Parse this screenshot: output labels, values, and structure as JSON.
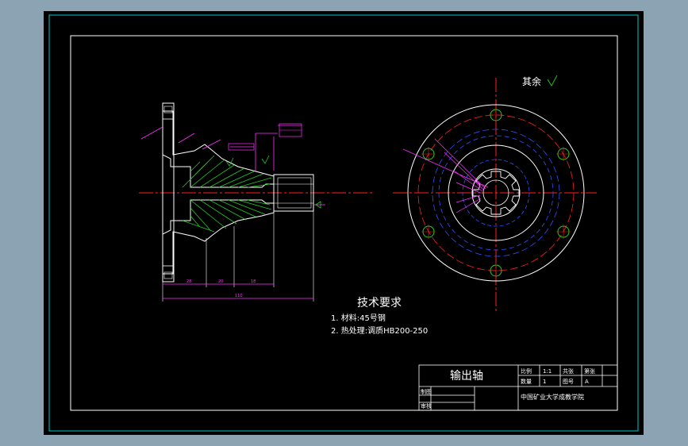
{
  "notes": {
    "rest_surface": "其余",
    "tech_title": "技术要求",
    "req1": "1. 材料:45号钢",
    "req2": "2. 热处理:调质HB200-250"
  },
  "title_block": {
    "part_name": "输出轴",
    "scale_label": "比例",
    "scale_value": "1:1",
    "sheet_label": "共张",
    "sheet_no_label": "第张",
    "qty_label": "数量",
    "qty_value": "1",
    "drawing_no_label": "图号",
    "drawing_no_value": "A",
    "drawn_label": "制图",
    "checked_label": "审核",
    "school": "中国矿业大学成教学院"
  },
  "dimensions": {
    "d1": "28",
    "d2": "20",
    "d3": "18",
    "total": "110"
  },
  "colors": {
    "background": "#000000",
    "outer_frame": "#ffffff",
    "inner_frame": "#00c8c8",
    "outline": "#ffffff",
    "centerline": "#ff2020",
    "hatch": "#22cc22",
    "dimension": "#ff30ff",
    "hidden": "#3050ff",
    "bolt_holes": "#22cc22"
  }
}
